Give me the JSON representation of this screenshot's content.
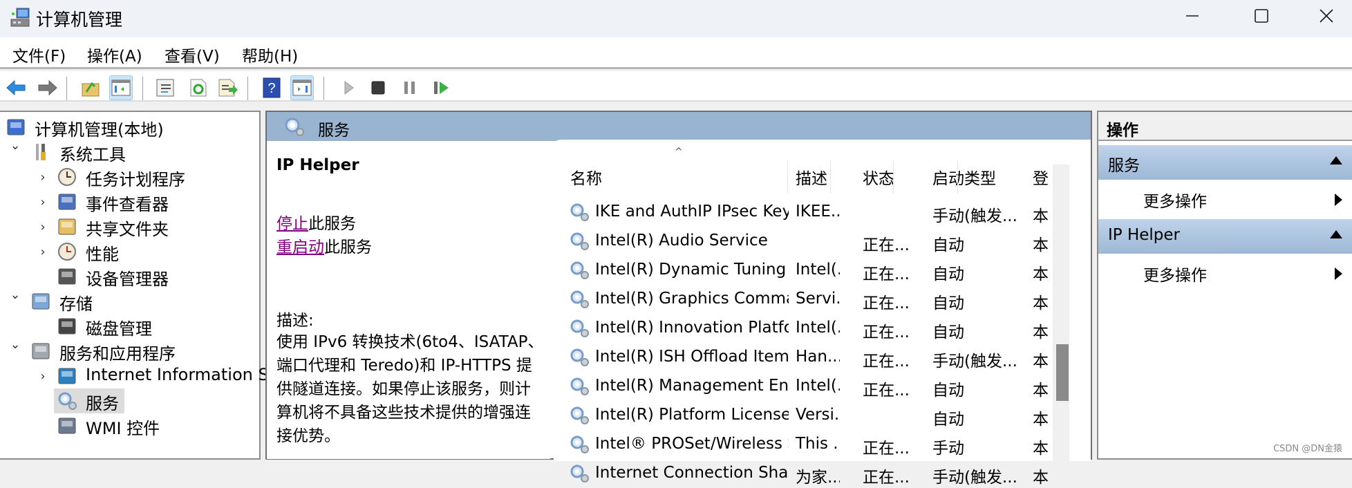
{
  "window": {
    "title": "计算机管理",
    "controls": {
      "minimize": "minimize",
      "maximize": "maximize",
      "close": "close"
    }
  },
  "menu": [
    "文件(F)",
    "操作(A)",
    "查看(V)",
    "帮助(H)"
  ],
  "toolbar": {
    "buttons": [
      {
        "icon": "back-arrow-icon",
        "state": "enabled"
      },
      {
        "icon": "forward-arrow-icon",
        "state": "disabled"
      },
      {
        "icon": "up-folder-icon",
        "state": "enabled"
      },
      {
        "icon": "show-hide-console-tree-icon",
        "state": "active"
      },
      {
        "icon": "properties-icon",
        "state": "enabled"
      },
      {
        "icon": "refresh-icon",
        "state": "enabled"
      },
      {
        "icon": "export-list-icon",
        "state": "enabled"
      },
      {
        "icon": "help-icon",
        "state": "enabled"
      },
      {
        "icon": "show-hide-action-pane-icon",
        "state": "active"
      },
      {
        "icon": "start-service-icon",
        "state": "disabled"
      },
      {
        "icon": "stop-service-icon",
        "state": "enabled"
      },
      {
        "icon": "pause-service-icon",
        "state": "disabled"
      },
      {
        "icon": "restart-service-icon",
        "state": "enabled"
      }
    ]
  },
  "tree": {
    "items": [
      {
        "label": "计算机管理(本地)",
        "level": 0,
        "expander": "none",
        "icon": "computer-management-icon"
      },
      {
        "label": "系统工具",
        "level": 1,
        "expander": "expanded",
        "icon": "tools-icon"
      },
      {
        "label": "任务计划程序",
        "level": 2,
        "expander": "collapsed",
        "icon": "clock-icon"
      },
      {
        "label": "事件查看器",
        "level": 2,
        "expander": "collapsed",
        "icon": "event-viewer-icon"
      },
      {
        "label": "共享文件夹",
        "level": 2,
        "expander": "collapsed",
        "icon": "shared-folder-icon"
      },
      {
        "label": "性能",
        "level": 2,
        "expander": "collapsed",
        "icon": "performance-icon"
      },
      {
        "label": "设备管理器",
        "level": 2,
        "expander": "none",
        "icon": "device-manager-icon"
      },
      {
        "label": "存储",
        "level": 1,
        "expander": "expanded",
        "icon": "storage-icon"
      },
      {
        "label": "磁盘管理",
        "level": 2,
        "expander": "none",
        "icon": "disk-icon"
      },
      {
        "label": "服务和应用程序",
        "level": 1,
        "expander": "expanded",
        "icon": "services-apps-icon"
      },
      {
        "label": "Internet Information Se",
        "level": 2,
        "expander": "collapsed",
        "icon": "iis-icon"
      },
      {
        "label": "服务",
        "level": 2,
        "expander": "none",
        "icon": "gear-icon",
        "selected": true
      },
      {
        "label": "WMI 控件",
        "level": 2,
        "expander": "none",
        "icon": "wmi-icon"
      }
    ]
  },
  "center": {
    "header": "服务",
    "detail": {
      "service_name": "IP Helper",
      "stop_link": "停止",
      "stop_suffix": "此服务",
      "restart_link": "重启动",
      "restart_suffix": "此服务",
      "desc_label": "描述:",
      "desc_lines": [
        "使用 IPv6 转换技术(6to4、ISATAP、",
        "端口代理和 Teredo)和 IP-HTTPS 提",
        "供隧道连接。如果停止该服务，则计",
        "算机将不具备这些技术提供的增强连",
        "接优势。"
      ]
    },
    "columns": [
      "名称",
      "描述",
      "状态",
      "启动类型",
      "登"
    ],
    "sort_indicator": "^",
    "rows": [
      {
        "name": "IKE and AuthIP IPsec Keyin...",
        "desc": "IKEE...",
        "status": "",
        "startup": "手动(触发...",
        "logon": "本"
      },
      {
        "name": "Intel(R) Audio Service",
        "desc": "",
        "status": "正在...",
        "startup": "自动",
        "logon": "本"
      },
      {
        "name": "Intel(R) Dynamic Tuning T...",
        "desc": "Intel(...",
        "status": "正在...",
        "startup": "自动",
        "logon": "本"
      },
      {
        "name": "Intel(R) Graphics Comman...",
        "desc": "Servi...",
        "status": "正在...",
        "startup": "自动",
        "logon": "本"
      },
      {
        "name": "Intel(R) Innovation Platfor...",
        "desc": "Intel(...",
        "status": "正在...",
        "startup": "自动",
        "logon": "本"
      },
      {
        "name": "Intel(R) ISH Offload Item S...",
        "desc": "Han...",
        "status": "正在...",
        "startup": "手动(触发...",
        "logon": "本"
      },
      {
        "name": "Intel(R) Management Engi...",
        "desc": "Intel(...",
        "status": "正在...",
        "startup": "自动",
        "logon": "本"
      },
      {
        "name": "Intel(R) Platform License M...",
        "desc": "Versi...",
        "status": "",
        "startup": "自动",
        "logon": "本"
      },
      {
        "name": "Intel® PROSet/Wireless S...",
        "desc": "This ...",
        "status": "正在...",
        "startup": "手动",
        "logon": "本"
      },
      {
        "name": "Internet Connection Sharin...",
        "desc": "为家...",
        "status": "正在...",
        "startup": "手动(触发...",
        "logon": "本"
      }
    ]
  },
  "actions": {
    "title": "操作",
    "groups": [
      {
        "label": "服务",
        "items": [
          "更多操作"
        ]
      },
      {
        "label": "IP Helper",
        "items": [
          "更多操作"
        ]
      }
    ]
  },
  "watermark": "CSDN @DN金猿"
}
